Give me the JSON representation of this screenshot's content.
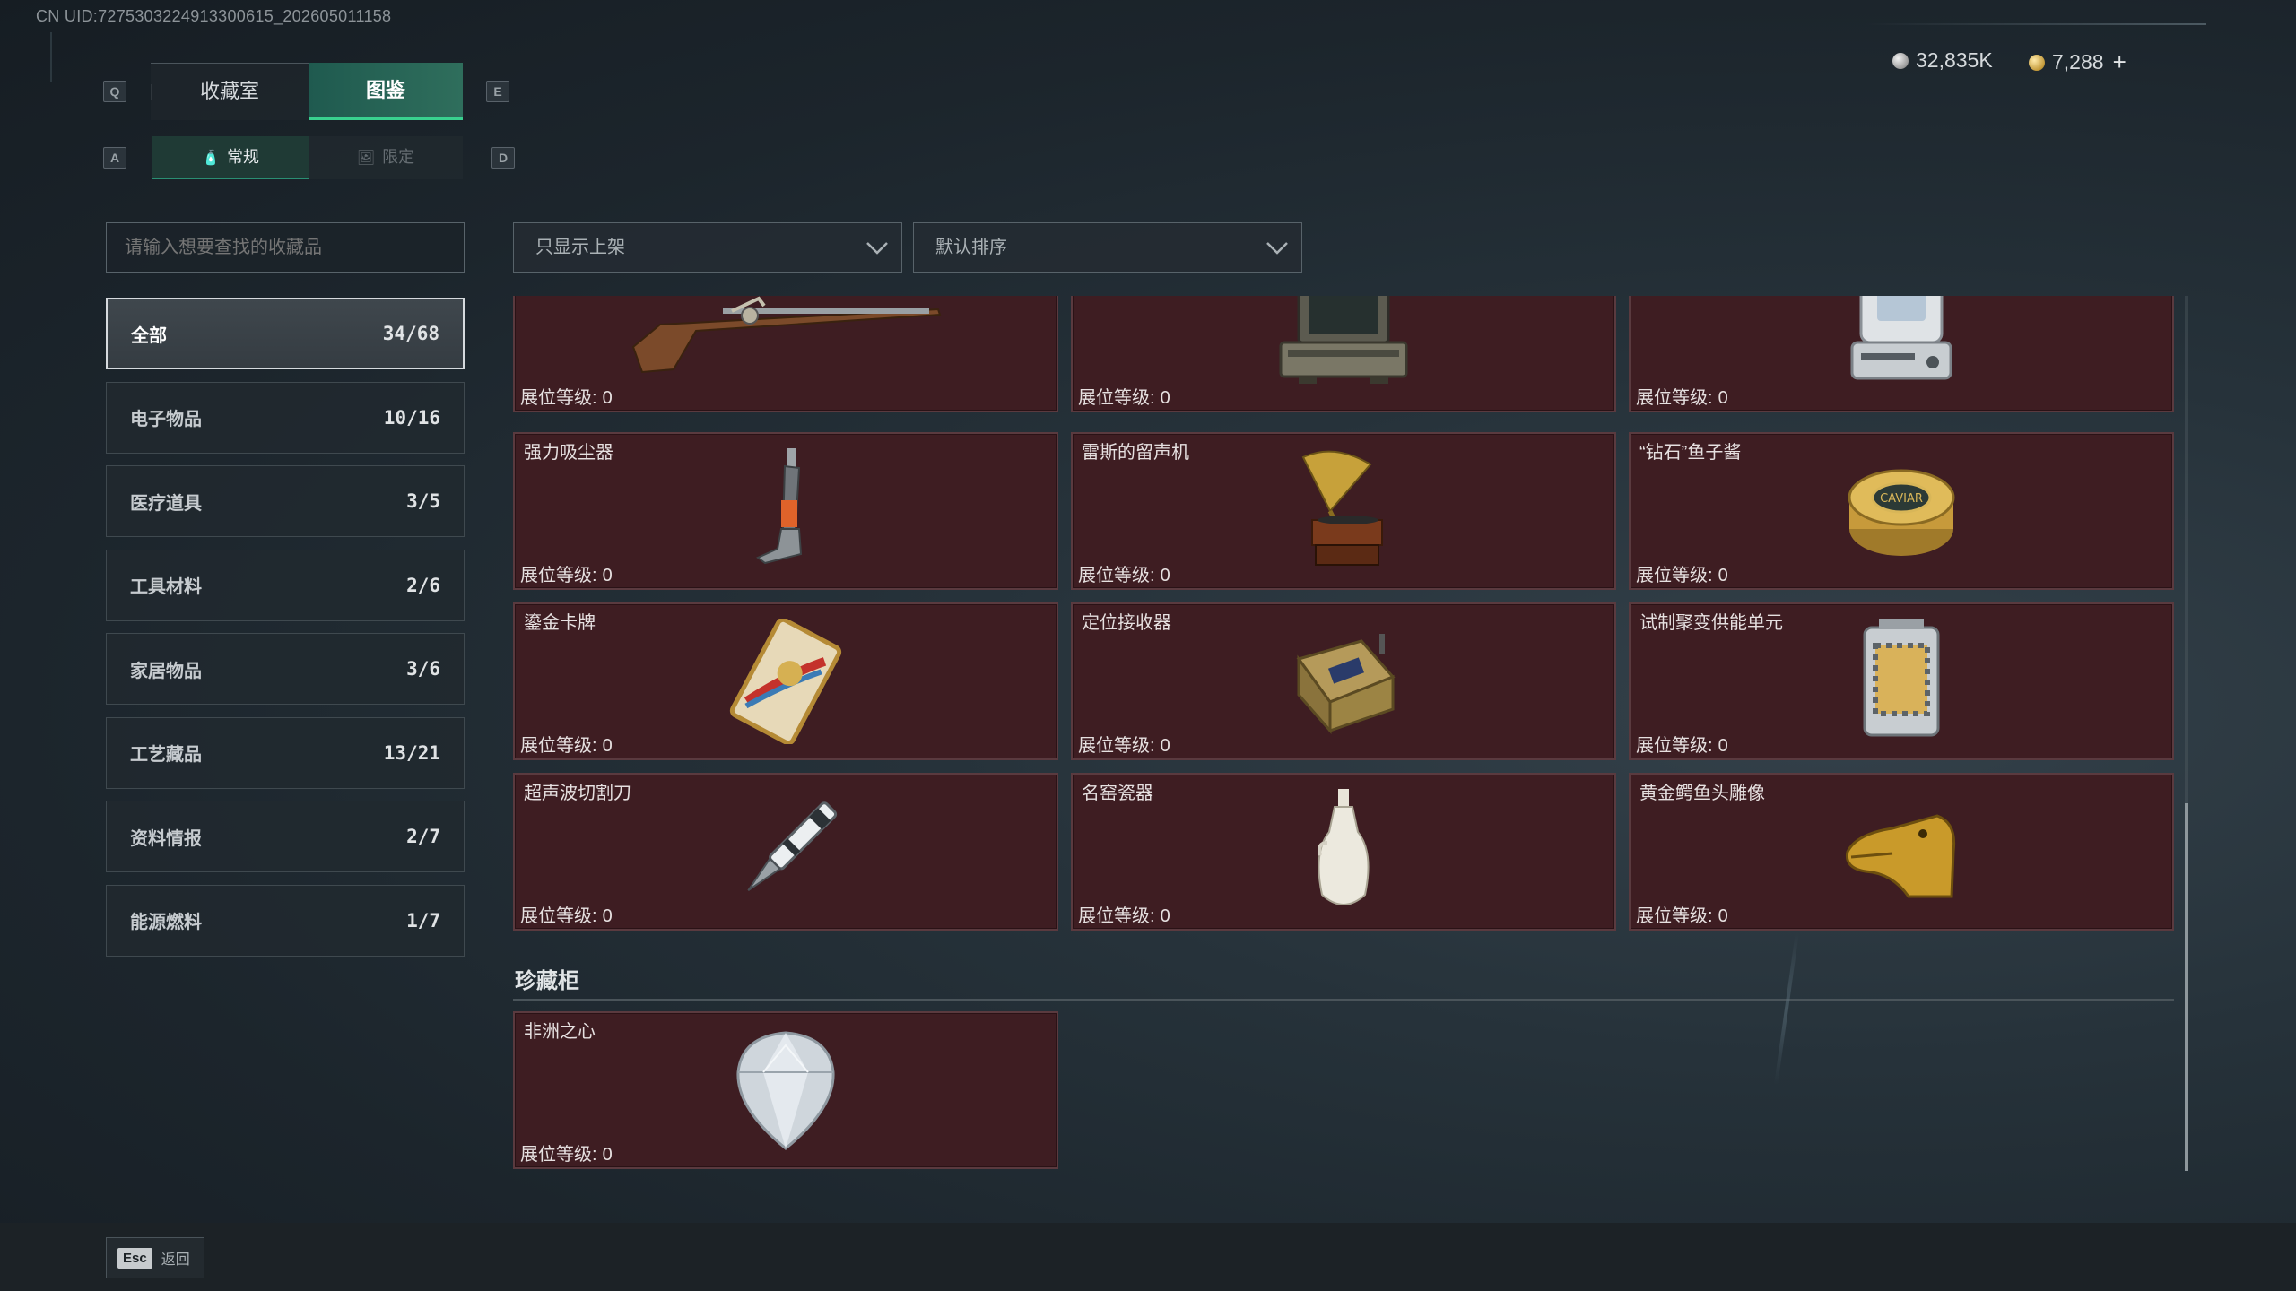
{
  "uid_text": "CN UID:7275303224913300615_202605011158",
  "top_tabs": {
    "prev_key": "Q",
    "next_key": "E",
    "items": [
      {
        "label": "收藏室"
      },
      {
        "label": "图鉴"
      }
    ]
  },
  "sub_tabs": {
    "prev_key": "A",
    "next_key": "D",
    "items": [
      {
        "label": "常规",
        "icon": "bottle-icon"
      },
      {
        "label": "限定",
        "icon": "image-icon"
      }
    ]
  },
  "currency": {
    "silver": "32,835K",
    "gold": "7,288",
    "silver_icon": "silver-coin-icon",
    "gold_icon": "gold-coin-icon",
    "add_icon": "plus-icon"
  },
  "search": {
    "placeholder": "请输入想要查找的收藏品"
  },
  "categories": [
    {
      "label": "全部",
      "count": "34/68",
      "active": true
    },
    {
      "label": "电子物品",
      "count": "10/16"
    },
    {
      "label": "医疗道具",
      "count": "3/5"
    },
    {
      "label": "工具材料",
      "count": "2/6"
    },
    {
      "label": "家居物品",
      "count": "3/6"
    },
    {
      "label": "工艺藏品",
      "count": "13/21"
    },
    {
      "label": "资料情报",
      "count": "2/7"
    },
    {
      "label": "能源燃料",
      "count": "1/7"
    }
  ],
  "filters": {
    "display": "只显示上架",
    "sort": "默认排序"
  },
  "level_label": "展位等级:",
  "items": [
    {
      "name": "",
      "level": "0",
      "icon": "flintlock-rifle-icon"
    },
    {
      "name": "",
      "level": "0",
      "icon": "rugged-laptop-icon"
    },
    {
      "name": "",
      "level": "0",
      "icon": "medical-device-icon"
    },
    {
      "name": "强力吸尘器",
      "level": "0",
      "icon": "vacuum-cleaner-icon"
    },
    {
      "name": "雷斯的留声机",
      "level": "0",
      "icon": "gramophone-icon"
    },
    {
      "name": "“钻石”鱼子酱",
      "level": "0",
      "icon": "caviar-tin-icon"
    },
    {
      "name": "鎏金卡牌",
      "level": "0",
      "icon": "gilded-card-icon"
    },
    {
      "name": "定位接收器",
      "level": "0",
      "icon": "locator-receiver-icon"
    },
    {
      "name": "试制聚变供能单元",
      "level": "0",
      "icon": "fusion-cell-icon"
    },
    {
      "name": "超声波切割刀",
      "level": "0",
      "icon": "ultrasonic-knife-icon"
    },
    {
      "name": "名窑瓷器",
      "level": "0",
      "icon": "porcelain-vase-icon"
    },
    {
      "name": "黄金鳄鱼头雕像",
      "level": "0",
      "icon": "golden-crocodile-icon"
    }
  ],
  "treasure_section": {
    "title": "珍藏柜",
    "items": [
      {
        "name": "非洲之心",
        "level": "0",
        "icon": "diamond-icon"
      }
    ]
  },
  "footer": {
    "esc_key": "Esc",
    "back_label": "返回"
  }
}
